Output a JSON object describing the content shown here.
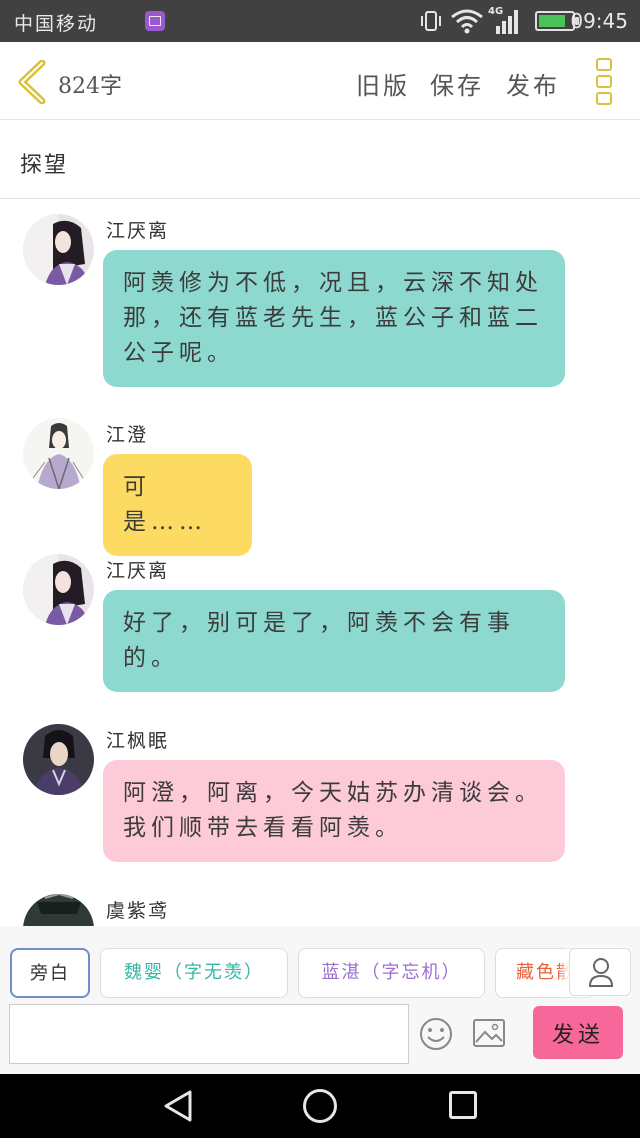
{
  "status_bar": {
    "carrier": "中国移动",
    "network": "4G",
    "time": "09:45",
    "icons": [
      "gallery-icon",
      "vibrate-icon",
      "wifi-icon",
      "signal-icon",
      "battery-charging-icon"
    ]
  },
  "header": {
    "word_count": "824字",
    "old_version": "旧版",
    "save": "保存",
    "publish": "发布",
    "accent_color": "#d8c23c"
  },
  "story": {
    "title": "探望"
  },
  "messages": [
    {
      "sender": "江厌离",
      "text": "阿羡修为不低，况且，云深不知处那，还有蓝老先生，蓝公子和蓝二公子呢。",
      "color": "#8dd9cf"
    },
    {
      "sender": "江澄",
      "text": "可是……",
      "color": "#fddb63"
    },
    {
      "sender": "江厌离",
      "text": "好了，别可是了，阿羡不会有事的。",
      "color": "#8dd9cf"
    },
    {
      "sender": "江枫眠",
      "text": "阿澄，阿离，今天姑苏办清谈会。我们顺带去看看阿羡。",
      "color": "#fdcad8"
    },
    {
      "sender": "虞紫鸢",
      "text": ""
    }
  ],
  "roles": {
    "narration": "旁白",
    "wei_ying": "魏婴（字无羡）",
    "lan_zhan": "蓝湛（字忘机）",
    "cang_se": "藏色散人"
  },
  "composer": {
    "input_value": "",
    "send": "发送",
    "send_color": "#f7679a"
  }
}
